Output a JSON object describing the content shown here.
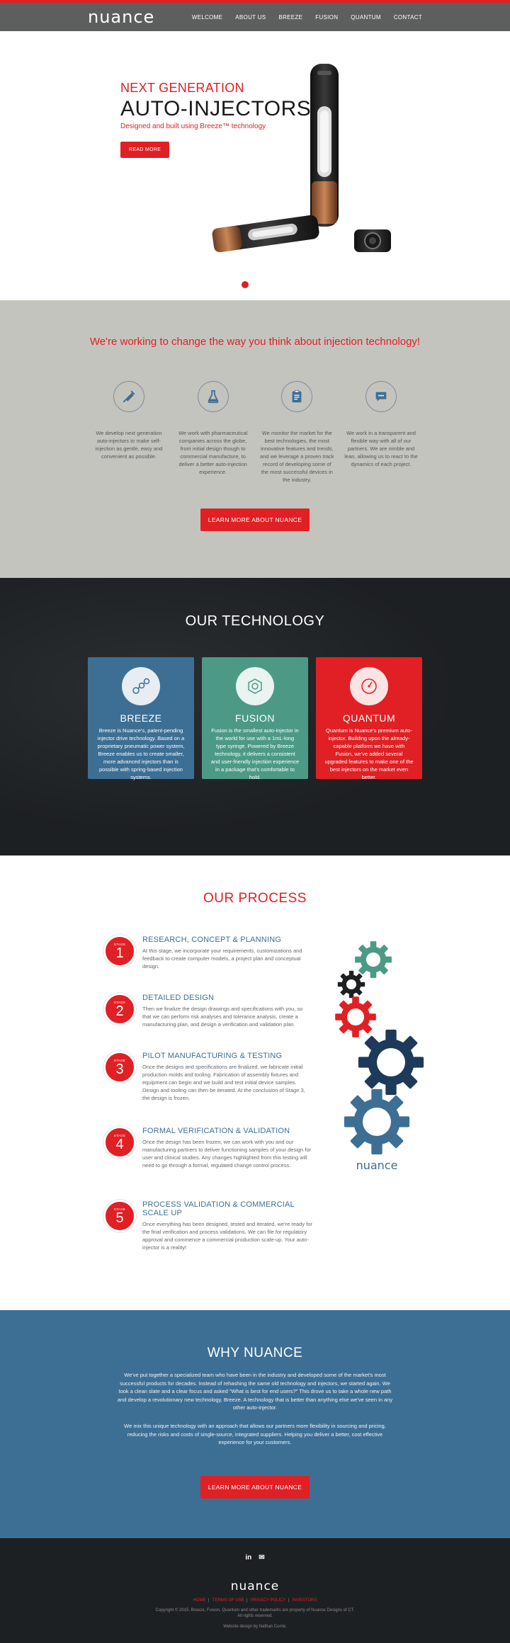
{
  "header": {
    "logo": "nuance",
    "nav": [
      "WELCOME",
      "ABOUT US",
      "BREEZE",
      "FUSION",
      "QUANTUM",
      "CONTACT"
    ]
  },
  "hero": {
    "eyebrow": "NEXT GENERATION",
    "title": "AUTO-INJECTORS",
    "subtitle": "Designed and built using Breeze™ technology",
    "button": "READ MORE"
  },
  "mission": {
    "title": "We're working to change the way you think about injection technology!",
    "columns": [
      {
        "icon": "syringe-icon",
        "text": "We develop next generation auto-injectors to make self-injection as gentle, easy and convenient as possible."
      },
      {
        "icon": "flask-icon",
        "text": "We work with pharmaceutical companies across the globe, from initial design though to commercial manufacture, to deliver a better auto-injection experience."
      },
      {
        "icon": "clipboard-icon",
        "text": "We monitor the market for the best technologies, the most innovative features and trends, and we leverage a proven track record of developing some of the most successful devices in the industry."
      },
      {
        "icon": "chat-icon",
        "text": "We work in a transparent and flexible way with all of our partners. We are nimble and lean, allowing us to react to the dynamics of each project."
      }
    ],
    "button": "LEARN MORE ABOUT NUANCE"
  },
  "technology": {
    "title": "OUR TECHNOLOGY",
    "cards": [
      {
        "name": "BREEZE",
        "icon": "molecule-icon",
        "text": "Breeze is Nuance's, patent-pending injector drive technology. Based on a proprietary pneumatic power system, Breeze enables us to create smaller, more advanced injectors than is possible with spring-based injection systems."
      },
      {
        "name": "FUSION",
        "icon": "hexagon-nut-icon",
        "text": "Fusion is the smallest auto-injector in the world for use with a 1mL-long type syringe. Powered by Breeze technology, it delivers a consistent and user-friendly injection experience in a package that's comfortable to hold."
      },
      {
        "name": "QUANTUM",
        "icon": "gauge-icon",
        "text": "Quantum is Nuance's premium auto-injector. Building upon the already-capable platform we have with Fusion, we've added several upgraded features to make one of the best injectors on the market even better."
      }
    ]
  },
  "process": {
    "title": "OUR PROCESS",
    "stage_label": "STAGE",
    "steps": [
      {
        "num": "1",
        "title": "RESEARCH, CONCEPT & PLANNING",
        "text": "At this stage, we incorporate your requirements, customizations and feedback to create computer models, a project plan and conceptual design."
      },
      {
        "num": "2",
        "title": "DETAILED DESIGN",
        "text": "Then we finalize the design drawings and specifications with you, so that we can perform risk analyses and tolerance analysis, create a manufacturing plan, and design a verification and validation plan."
      },
      {
        "num": "3",
        "title": "PILOT MANUFACTURING & TESTING",
        "text": "Once the designs and specifications are finalized, we fabricate initial production molds and tooling. Fabrication of assembly fixtures and equipment can begin and we build and test initial device samples. Design and tooling can then be iterated. At the conclusion of Stage 3, the design is frozen."
      },
      {
        "num": "4",
        "title": "FORMAL VERIFICATION & VALIDATION",
        "text": "Once the design has been frozen, we can work with you and our manufacturing partners to deliver functioning samples of your design for user and clinical studies. Any changes highlighted from this testing will need to go through a formal, regulated change control process."
      },
      {
        "num": "5",
        "title": "PROCESS VALIDATION & COMMERCIAL SCALE UP",
        "text": "Once everything has been designed, tested and iterated, we're ready for the final verification and process validations. We can file for regulatory approval and commence a commercial production scale-up. Your auto-injector is a reality!"
      }
    ],
    "gears_logo": "nuance",
    "gear_colors": [
      "#4c9a86",
      "#1d2023",
      "#e02024",
      "#1d3a5a",
      "#3d6f95"
    ]
  },
  "why": {
    "title": "WHY NUANCE",
    "p1": "We've put together a specialized team who have been in the industry and developed some of the market's most successful products for decades. Instead of rehashing the same old technology and injectors, we started again. We took a clean slate and a clear focus and asked \"What is best for end users?\" This drove us to take a whole new path and develop a revolutionary new technology, Breeze. A technology that is better than anything else we've seen in any other auto-injector.",
    "p2": "We mix this unique technology with an approach that allows our partners more flexibility in sourcing and pricing, reducing the risks and costs of single-source, integrated suppliers. Helping you deliver a better, cost effective experience for your customers.",
    "button": "LEARN MORE ABOUT NUANCE"
  },
  "footer": {
    "social": [
      "in",
      "✉"
    ],
    "logo": "nuance",
    "links": [
      "HOME",
      "TERMS OF USE",
      "PRIVACY POLICY",
      "INVESTORS"
    ],
    "copyright": "Copyright © 2015. Breeze, Fusion, Quantum and other trademarks are property of Nuance Designs of CT.",
    "rights": "All rights reserved.",
    "credit": "Website design by Nathan Currie."
  },
  "colors": {
    "accent": "#e02024",
    "blue": "#3d6f95",
    "teal": "#4c9a86",
    "dark": "#1d2023",
    "gray": "#c4c4bf"
  }
}
